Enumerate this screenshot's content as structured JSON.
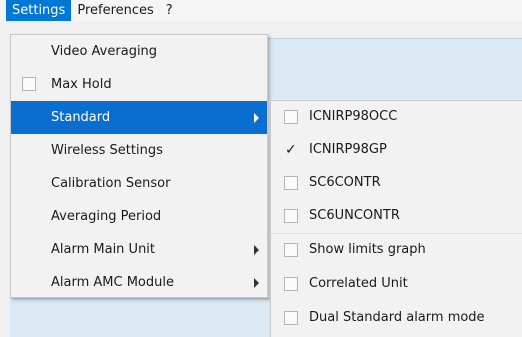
{
  "menubar": {
    "items": [
      "Settings",
      "Preferences",
      "?"
    ]
  },
  "settings_menu": {
    "items": [
      {
        "label": "Video Averaging",
        "checkbox": false,
        "checked": false,
        "submenu": false
      },
      {
        "label": "Max Hold",
        "checkbox": true,
        "checked": false,
        "submenu": false
      },
      {
        "label": "Standard",
        "checkbox": false,
        "checked": false,
        "submenu": true,
        "highlighted": true
      },
      {
        "label": "Wireless Settings",
        "checkbox": false,
        "checked": false,
        "submenu": false
      },
      {
        "label": "Calibration Sensor",
        "checkbox": false,
        "checked": false,
        "submenu": false
      },
      {
        "label": "Averaging Period",
        "checkbox": false,
        "checked": false,
        "submenu": false
      },
      {
        "label": "Alarm Main Unit",
        "checkbox": false,
        "checked": false,
        "submenu": true
      },
      {
        "label": "Alarm AMC Module",
        "checkbox": false,
        "checked": false,
        "submenu": true
      }
    ]
  },
  "standard_submenu": {
    "items": [
      {
        "label": "ICNIRP98OCC",
        "checked": false
      },
      {
        "label": "ICNIRP98GP",
        "checked": true
      },
      {
        "label": "SC6CONTR",
        "checked": false
      },
      {
        "label": "SC6UNCONTR",
        "checked": false
      },
      {
        "label": "Show limits graph",
        "checked": false
      },
      {
        "label": "Correlated Unit",
        "checked": false
      },
      {
        "label": "Dual Standard alarm mode",
        "checked": false
      }
    ]
  },
  "colors": {
    "highlight": "#0a6ed1",
    "menubar_active": "#0078d7",
    "background_panel": "#dbe9f5"
  }
}
